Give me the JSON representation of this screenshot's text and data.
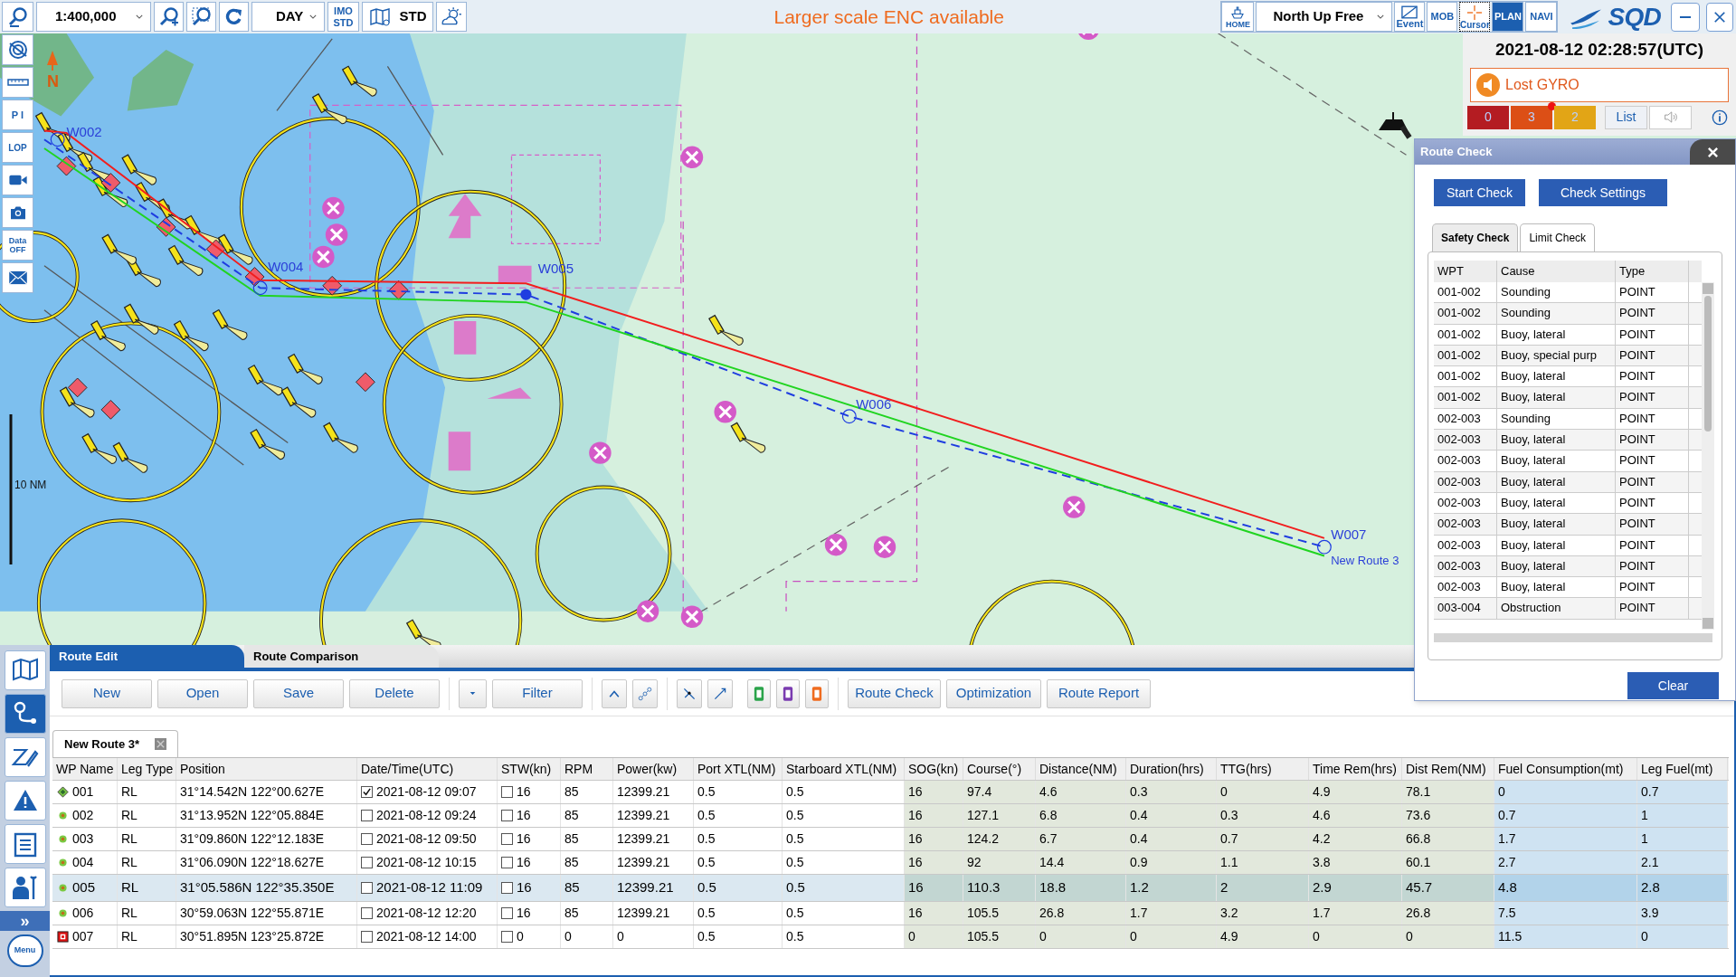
{
  "top_bar": {
    "scale": "1:400,000",
    "palette": "DAY",
    "imo_button": "IMO STD",
    "chart_display": "STD",
    "notice": "Larger scale ENC available",
    "home": "HOME",
    "orientation": "North Up Free",
    "event": "Event",
    "mob": "MOB",
    "cursor": "Cursor",
    "modes": [
      {
        "label": "PLAN",
        "selected": true
      },
      {
        "label": "NAVI",
        "selected": false
      }
    ],
    "logo": "SQD"
  },
  "side_tools": {
    "pi": "P I",
    "lop": "LOP",
    "data": "Data OFF"
  },
  "chart": {
    "north": "N",
    "scale_bar": "10 NM",
    "waypoint_labels": [
      "W002",
      "W004",
      "W005",
      "W006",
      "W007"
    ],
    "route_name": "New Route 3"
  },
  "status": {
    "datetime": "2021-08-12 02:28:57(UTC)",
    "alarm": "Lost GYRO",
    "counters": [
      {
        "count": "0",
        "color": "#b41c22",
        "new": false
      },
      {
        "count": "3",
        "color": "#dc4f16",
        "new": true
      },
      {
        "count": "2",
        "color": "#e2a516",
        "new": false
      }
    ],
    "list_button": "List"
  },
  "route_check": {
    "title": "Route Check",
    "buttons": [
      "Start Check",
      "Check Settings"
    ],
    "tabs": [
      {
        "label": "Safety Check",
        "selected": true
      },
      {
        "label": "Limit Check",
        "selected": false
      }
    ],
    "columns": [
      "WPT",
      "Cause",
      "Type"
    ],
    "rows": [
      [
        "001-002",
        "Sounding",
        "POINT"
      ],
      [
        "001-002",
        "Sounding",
        "POINT"
      ],
      [
        "001-002",
        "Buoy, lateral",
        "POINT"
      ],
      [
        "001-002",
        "Buoy, special purp",
        "POINT"
      ],
      [
        "001-002",
        "Buoy, lateral",
        "POINT"
      ],
      [
        "001-002",
        "Buoy, lateral",
        "POINT"
      ],
      [
        "002-003",
        "Sounding",
        "POINT"
      ],
      [
        "002-003",
        "Buoy, lateral",
        "POINT"
      ],
      [
        "002-003",
        "Buoy, lateral",
        "POINT"
      ],
      [
        "002-003",
        "Buoy, lateral",
        "POINT"
      ],
      [
        "002-003",
        "Buoy, lateral",
        "POINT"
      ],
      [
        "002-003",
        "Buoy, lateral",
        "POINT"
      ],
      [
        "002-003",
        "Buoy, lateral",
        "POINT"
      ],
      [
        "002-003",
        "Buoy, lateral",
        "POINT"
      ],
      [
        "002-003",
        "Buoy, lateral",
        "POINT"
      ],
      [
        "003-004",
        "Obstruction",
        "POINT"
      ]
    ],
    "clear": "Clear"
  },
  "route_edit": {
    "tabs": [
      {
        "label": "Route Edit",
        "selected": true
      },
      {
        "label": "Route Comparison",
        "selected": false
      }
    ],
    "buttons": {
      "file": [
        "New",
        "Open",
        "Save",
        "Delete"
      ],
      "filter": "Filter",
      "actions": [
        "Route Check",
        "Optimization",
        "Route Report"
      ]
    },
    "route_tabs": [
      {
        "label": "New Route 3*",
        "selected": true
      }
    ],
    "columns": [
      "WP Name",
      "Leg Type",
      "Position",
      "Date/Time(UTC)",
      "STW(kn)",
      "RPM",
      "Power(kw)",
      "Port XTL(NM)",
      "Starboard XTL(NM)",
      "SOG(kn)",
      "Course(°)",
      "Distance(NM)",
      "Duration(hrs)",
      "TTG(hrs)",
      "Time Rem(hrs)",
      "Dist Rem(NM)",
      "Fuel Consumption(mt)",
      "Leg Fuel(mt)"
    ],
    "rows": [
      {
        "kind": "start",
        "selected": false,
        "time_fixed": true,
        "stw_fixed": false,
        "cells": [
          "001",
          "RL",
          "31°14.542N 122°00.627E",
          "2021-08-12 09:07",
          "16",
          "85",
          "12399.21",
          "0.5",
          "0.5",
          "16",
          "97.4",
          "4.6",
          "0.3",
          "0",
          "4.9",
          "78.1",
          "0",
          "0.7"
        ]
      },
      {
        "kind": "waypoint",
        "selected": false,
        "time_fixed": false,
        "stw_fixed": false,
        "cells": [
          "002",
          "RL",
          "31°13.952N 122°05.884E",
          "2021-08-12 09:24",
          "16",
          "85",
          "12399.21",
          "0.5",
          "0.5",
          "16",
          "127.1",
          "6.8",
          "0.4",
          "0.3",
          "4.6",
          "73.6",
          "0.7",
          "1"
        ]
      },
      {
        "kind": "waypoint",
        "selected": false,
        "time_fixed": false,
        "stw_fixed": false,
        "cells": [
          "003",
          "RL",
          "31°09.860N 122°12.183E",
          "2021-08-12 09:50",
          "16",
          "85",
          "12399.21",
          "0.5",
          "0.5",
          "16",
          "124.2",
          "6.7",
          "0.4",
          "0.7",
          "4.2",
          "66.8",
          "1.7",
          "1"
        ]
      },
      {
        "kind": "waypoint",
        "selected": false,
        "time_fixed": false,
        "stw_fixed": false,
        "cells": [
          "004",
          "RL",
          "31°06.090N 122°18.627E",
          "2021-08-12 10:15",
          "16",
          "85",
          "12399.21",
          "0.5",
          "0.5",
          "16",
          "92",
          "14.4",
          "0.9",
          "1.1",
          "3.8",
          "60.1",
          "2.7",
          "2.1"
        ]
      },
      {
        "kind": "waypoint",
        "selected": true,
        "time_fixed": false,
        "stw_fixed": false,
        "cells": [
          "005",
          "RL",
          "31°05.586N 122°35.350E",
          "2021-08-12 11:09",
          "16",
          "85",
          "12399.21",
          "0.5",
          "0.5",
          "16",
          "110.3",
          "18.8",
          "1.2",
          "2",
          "2.9",
          "45.7",
          "4.8",
          "2.8"
        ]
      },
      {
        "kind": "waypoint",
        "selected": false,
        "time_fixed": false,
        "stw_fixed": false,
        "cells": [
          "006",
          "RL",
          "30°59.063N 122°55.871E",
          "2021-08-12 12:20",
          "16",
          "85",
          "12399.21",
          "0.5",
          "0.5",
          "16",
          "105.5",
          "26.8",
          "1.7",
          "3.2",
          "1.7",
          "26.8",
          "7.5",
          "3.9"
        ]
      },
      {
        "kind": "end",
        "selected": false,
        "time_fixed": false,
        "stw_fixed": false,
        "cells": [
          "007",
          "RL",
          "30°51.895N 123°25.872E",
          "2021-08-12 14:00",
          "0",
          "0",
          "0",
          "0.5",
          "0.5",
          "0",
          "105.5",
          "0",
          "0",
          "4.9",
          "0",
          "0",
          "11.5",
          "0"
        ]
      }
    ]
  },
  "bottom_nav": {
    "items": [
      {
        "selected": false
      },
      {
        "selected": true
      },
      {
        "selected": false
      },
      {
        "selected": false
      },
      {
        "selected": false
      },
      {
        "selected": false
      }
    ],
    "more": "»",
    "menu": "Menu"
  }
}
